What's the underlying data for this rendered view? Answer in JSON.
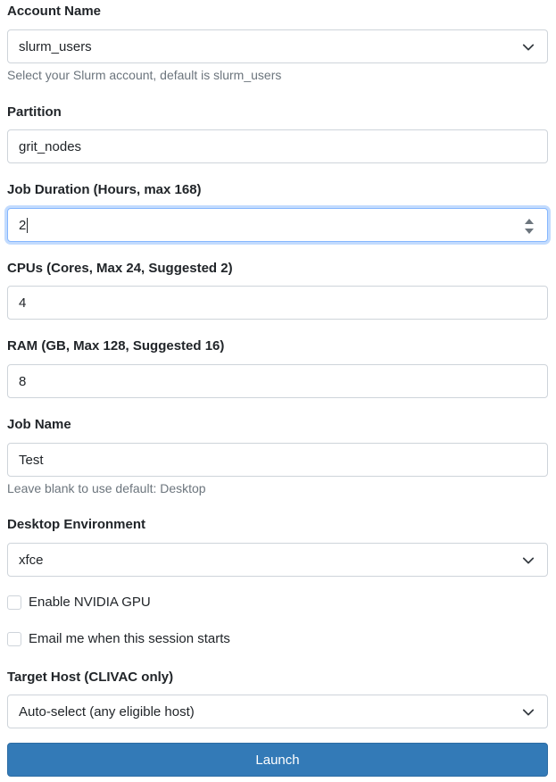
{
  "account": {
    "label": "Account Name",
    "value": "slurm_users",
    "help": "Select your Slurm account, default is slurm_users"
  },
  "partition": {
    "label": "Partition",
    "value": "grit_nodes"
  },
  "duration": {
    "label": "Job Duration (Hours, max 168)",
    "value": "2"
  },
  "cpus": {
    "label": "CPUs (Cores, Max 24, Suggested 2)",
    "value": "4"
  },
  "ram": {
    "label": "RAM (GB, Max 128, Suggested 16)",
    "value": "8"
  },
  "job_name": {
    "label": "Job Name",
    "value": "Test",
    "help": "Leave blank to use default: Desktop"
  },
  "desktop": {
    "label": "Desktop Environment",
    "value": "xfce"
  },
  "gpu": {
    "label": "Enable NVIDIA GPU",
    "checked": false
  },
  "email": {
    "label": "Email me when this session starts",
    "checked": false
  },
  "target_host": {
    "label": "Target Host (CLIVAC only)",
    "value": "Auto-select (any eligible host)"
  },
  "launch": {
    "label": "Launch"
  },
  "colors": {
    "primary_button": "#337ab7",
    "focus_border": "#86b7fe",
    "help_text": "#6c757d"
  }
}
